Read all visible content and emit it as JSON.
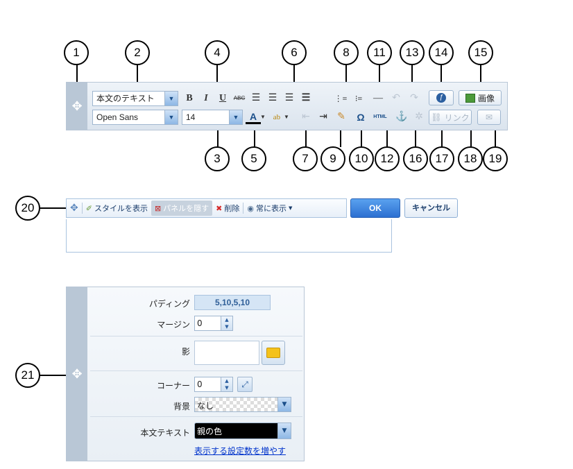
{
  "callouts": [
    "1",
    "2",
    "3",
    "4",
    "5",
    "6",
    "7",
    "8",
    "9",
    "10",
    "11",
    "12",
    "13",
    "14",
    "15",
    "16",
    "17",
    "18",
    "19",
    "20",
    "21"
  ],
  "toolbar": {
    "paragraph_format": "本文のテキスト",
    "font_family": "Open Sans",
    "font_size": "14",
    "bold": "B",
    "italic": "I",
    "underline": "U",
    "strike": "ABC",
    "html": "HTML",
    "omega": "Ω",
    "image_button": "画像",
    "link_button": "リンク",
    "font_color": "A"
  },
  "panel20": {
    "show_style": "スタイルを表示",
    "hide_panel": "パネルを隠す",
    "delete": "削除",
    "always_show": "常に表示",
    "ok": "OK",
    "cancel": "キャンセル"
  },
  "panel21": {
    "padding_label": "パディング",
    "padding_value": "5,10,5,10",
    "margin_label": "マージン",
    "margin_value": "0",
    "shadow_label": "影",
    "corner_label": "コーナー",
    "corner_value": "0",
    "background_label": "背景",
    "background_value": "なし",
    "body_text_label": "本文テキスト",
    "body_text_value": "親の色",
    "more_settings_link": "表示する設定数を増やす"
  },
  "colors": {
    "accent": "#2c6fd1",
    "grip": "#b9c7d6"
  }
}
